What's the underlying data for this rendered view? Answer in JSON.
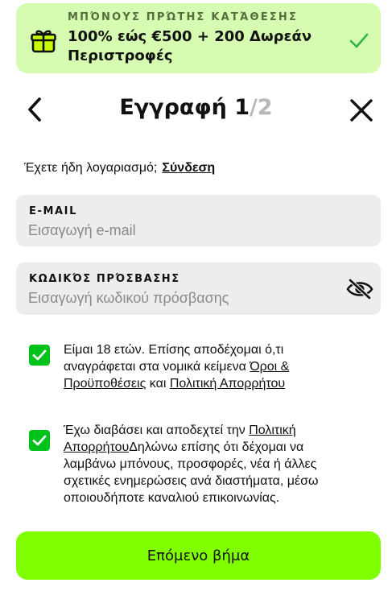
{
  "bonus": {
    "eyebrow": "ΜΠΌΝΟΥΣ ΠΡΏΤΗΣ ΚΑΤΆΘΕΣΗΣ",
    "headline": "100% εώς €500 + 200 Δωρεάν Περιστροφές",
    "icon": "gift-icon",
    "status_icon": "check-icon",
    "background": "#d5fcb0"
  },
  "header": {
    "title": "Εγγραφή",
    "step_current": "1",
    "step_total": "/2",
    "back_icon": "chevron-left-icon",
    "close_icon": "close-icon"
  },
  "login": {
    "prompt": "Έχετε ήδη λογαριασμό;",
    "link": "Σύνδεση"
  },
  "form": {
    "email": {
      "label": "E-MAIL",
      "placeholder": "Εισαγωγή e-mail",
      "value": ""
    },
    "password": {
      "label": "ΚΩΔΙΚΌΣ ΠΡΌΣΒΑΣΗΣ",
      "placeholder": "Εισαγωγή κωδικού πρόσβασης",
      "value": "",
      "toggle_icon": "eye-slash-icon"
    }
  },
  "consents": [
    {
      "checked": true,
      "text_before": "Είμαι 18 ετών. Επίσης αποδέχομαι ό,τι αναγράφεται στα νομικά κείμενα ",
      "link1": "Όροι & Προϋποθέσεις",
      "text_middle": " και ",
      "link2": "Πολιτική Απορρήτου",
      "text_after": ""
    },
    {
      "checked": true,
      "text_before": "Έχω διαβάσει και αποδεχτεί την ",
      "link1": "Πολιτική Απορρήτου",
      "text_after": "Δηλώνω επίσης ότι δέχομαι να λαμβάνω μπόνους, προσφορές, νέα ή άλλες σχετικές ενημερώσεις ανά διαστήματα, μέσω οποιουδήποτε καναλιού επικοινωνίας."
    }
  ],
  "actions": {
    "next_label": "Επόμενο βήμα"
  },
  "colors": {
    "accent": "#7fff00",
    "checkbox": "#00c21b",
    "field_bg": "#ededed"
  }
}
